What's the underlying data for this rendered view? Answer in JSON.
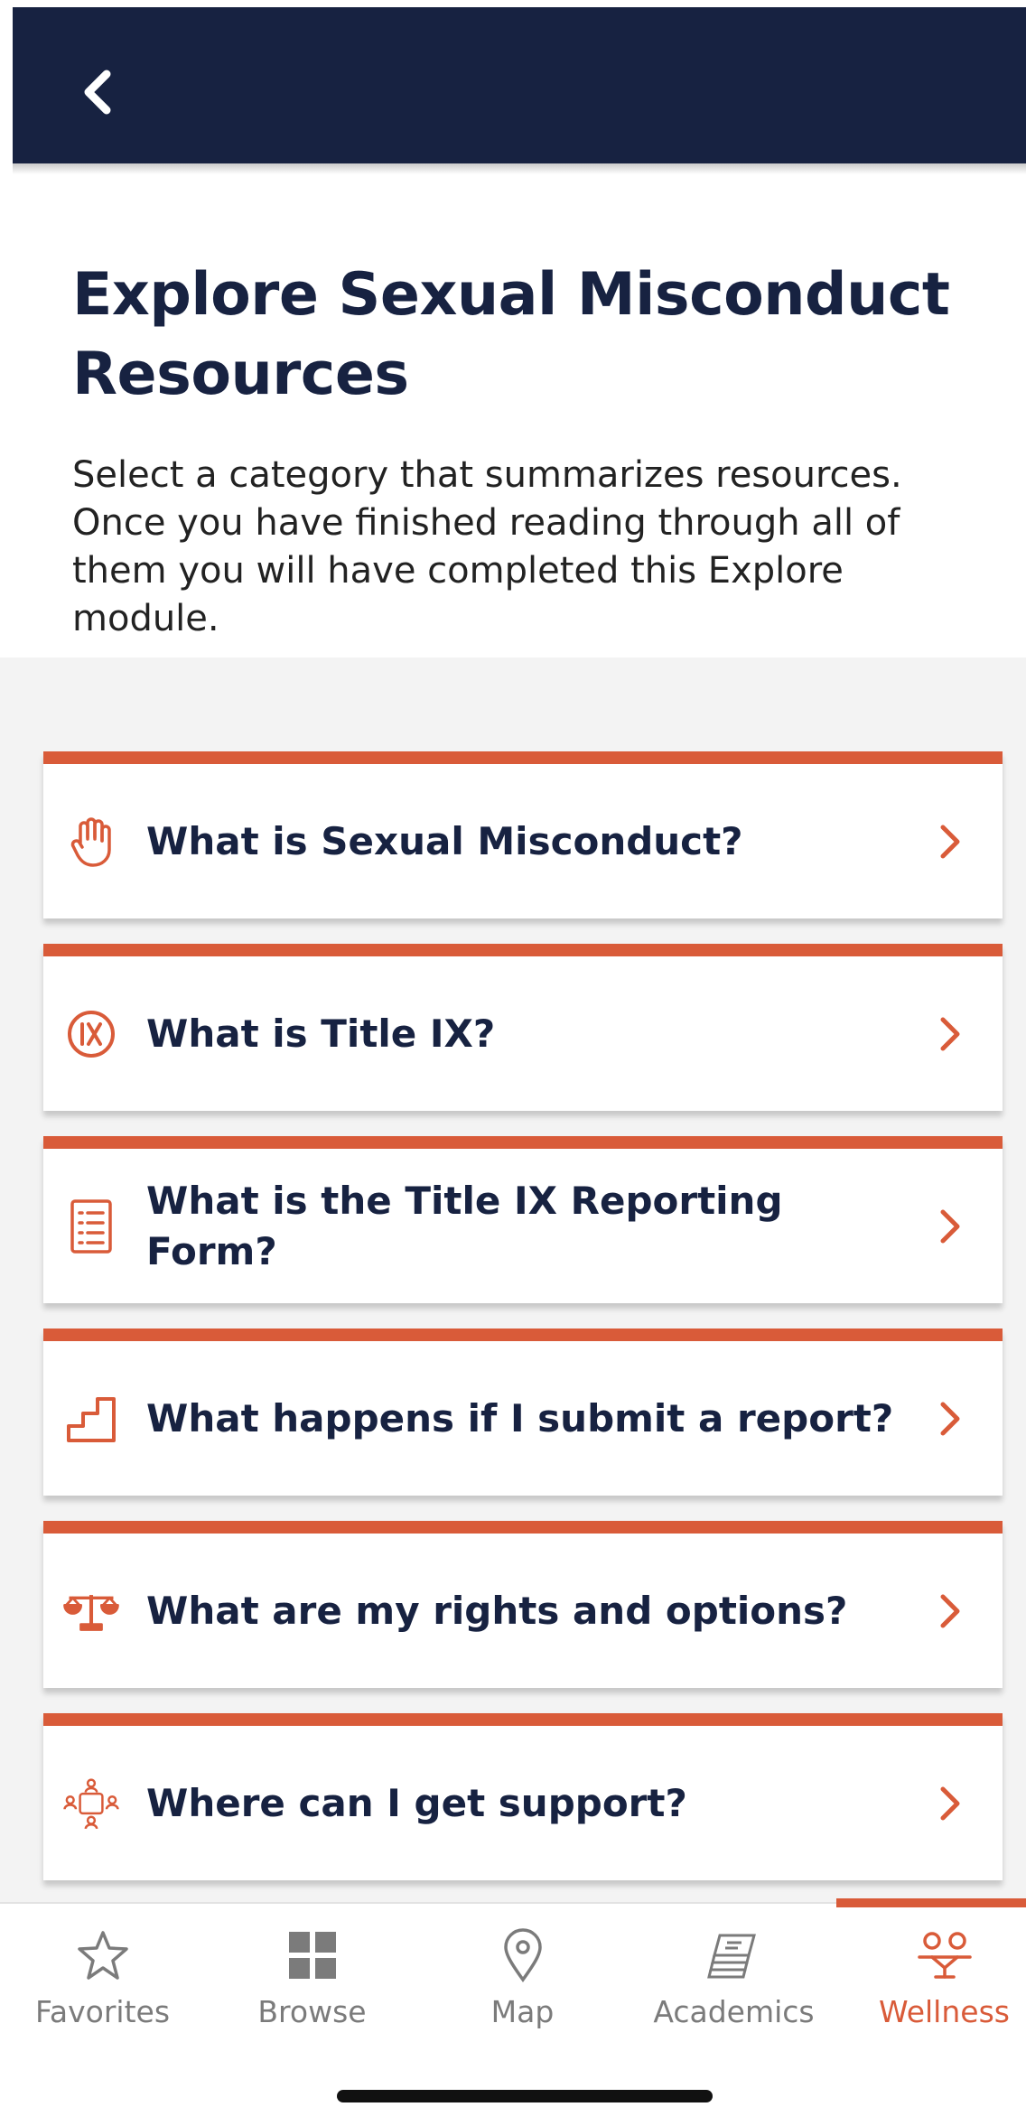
{
  "header": {
    "back_icon": "chevron-left-icon",
    "bg_color": "#172241"
  },
  "intro": {
    "title": "Explore Sexual Misconduct Resources",
    "description": "Select a category that summarizes resources. Once you have finished reading through all of them you will have completed this Explore module."
  },
  "theme": {
    "accent": "#d95b39",
    "navy": "#172241",
    "list_bg": "#f3f3f3"
  },
  "categories": [
    {
      "label": "What is Sexual Misconduct?",
      "icon": "hand-stop-icon"
    },
    {
      "label": "What is Title IX?",
      "icon": "title-ix-icon"
    },
    {
      "label": "What is the Title IX Reporting Form?",
      "icon": "form-list-icon"
    },
    {
      "label": "What happens if I submit a report?",
      "icon": "steps-icon"
    },
    {
      "label": "What are my rights and options?",
      "icon": "scales-icon"
    },
    {
      "label": "Where can I get support?",
      "icon": "support-network-icon"
    }
  ],
  "tabs": [
    {
      "label": "Favorites",
      "icon": "star-icon",
      "active": false
    },
    {
      "label": "Browse",
      "icon": "grid-icon",
      "active": false
    },
    {
      "label": "Map",
      "icon": "map-pin-icon",
      "active": false
    },
    {
      "label": "Academics",
      "icon": "books-icon",
      "active": false
    },
    {
      "label": "Wellness",
      "icon": "wellness-icon",
      "active": true
    }
  ]
}
